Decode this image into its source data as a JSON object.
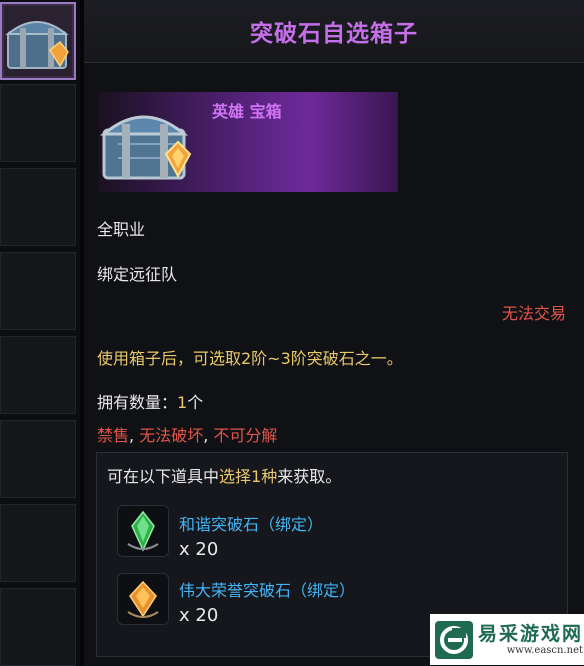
{
  "title": "突破石自选箱子",
  "item": {
    "rarity": "英雄 宝箱",
    "icon": "treasure-chest-icon"
  },
  "class_req": "全职业",
  "bind_type": "绑定远征队",
  "trade_status": "无法交易",
  "description": "使用箱子后，可选取2阶~3阶突破石之一。",
  "owned": {
    "label": "拥有数量：",
    "count": "1",
    "unit": "个"
  },
  "restrictions": {
    "sale": "禁售",
    "sep1": ", ",
    "destroy": "无法破坏",
    "sep2": ", ",
    "decompose": "不可分解"
  },
  "acquire": {
    "prefix": "可在以下道具中",
    "highlight": "选择1种",
    "suffix": "来获取。",
    "options": [
      {
        "name": "和谐突破石（绑定）",
        "qty": "x 20",
        "icon": "green-crystal-icon"
      },
      {
        "name": "伟大荣誉突破石（绑定）",
        "qty": "x 20",
        "icon": "orange-crystal-icon"
      }
    ]
  },
  "watermark": {
    "name": "易采游戏网",
    "url": "www.eascn.net",
    "icon": "site-logo-icon"
  },
  "colors": {
    "title": "#c46ee8",
    "warning": "#e2554a",
    "gold": "#e8c86a",
    "link": "#43b3f3"
  }
}
